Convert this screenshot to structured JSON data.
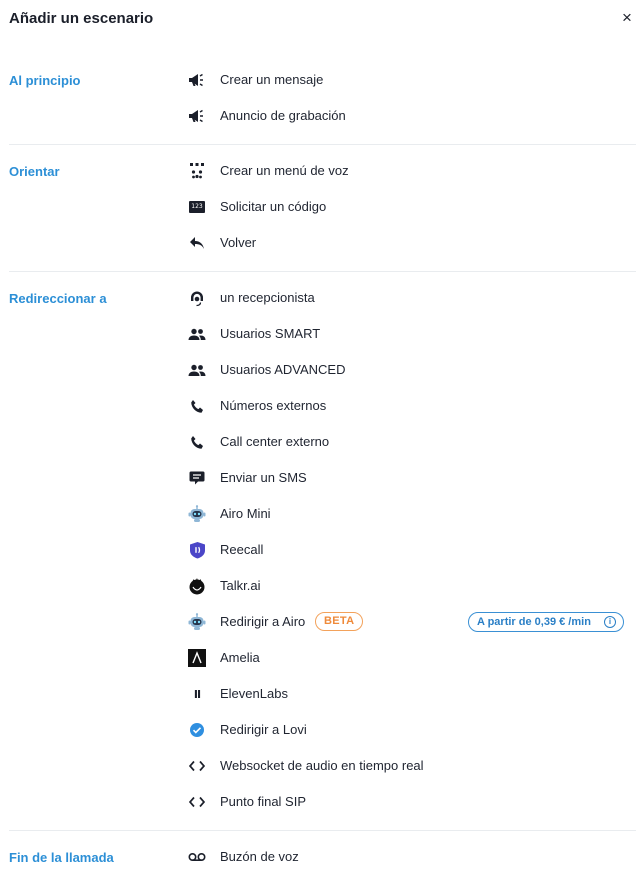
{
  "header": {
    "title": "Añadir un escenario",
    "close_label": "×"
  },
  "sections": [
    {
      "title": "Al principio",
      "items": [
        {
          "icon": "megaphone-icon",
          "label": "Crear un mensaje"
        },
        {
          "icon": "megaphone-icon",
          "label": "Anuncio de grabación"
        }
      ]
    },
    {
      "title": "Orientar",
      "items": [
        {
          "icon": "dialpad-icon",
          "label": "Crear un menú de voz"
        },
        {
          "icon": "keypad-code-icon",
          "label": "Solicitar un código",
          "glyph": "123"
        },
        {
          "icon": "reply-icon",
          "label": "Volver"
        }
      ]
    },
    {
      "title": "Redireccionar a",
      "items": [
        {
          "icon": "receptionist-icon",
          "label": "un recepcionista"
        },
        {
          "icon": "group-icon",
          "label": "Usuarios SMART"
        },
        {
          "icon": "group-icon",
          "label": "Usuarios ADVANCED"
        },
        {
          "icon": "phone-icon",
          "label": "Números externos"
        },
        {
          "icon": "phone-icon",
          "label": "Call center externo"
        },
        {
          "icon": "sms-icon",
          "label": "Enviar un SMS"
        },
        {
          "icon": "robot-icon",
          "label": "Airo Mini"
        },
        {
          "icon": "reecall-logo-icon",
          "label": "Reecall"
        },
        {
          "icon": "talkr-logo-icon",
          "label": "Talkr.ai"
        },
        {
          "icon": "robot-icon",
          "label": "Redirigir a Airo",
          "badge": "BETA",
          "price": "A partir de 0,39 € /min",
          "price_info": "i"
        },
        {
          "icon": "amelia-logo-icon",
          "label": "Amelia"
        },
        {
          "icon": "elevenlabs-logo-icon",
          "label": "ElevenLabs",
          "glyph": "II"
        },
        {
          "icon": "lovi-check-icon",
          "label": "Redirigir a Lovi"
        },
        {
          "icon": "code-icon",
          "label": "Websocket de audio en tiempo real"
        },
        {
          "icon": "code-icon",
          "label": "Punto final SIP"
        }
      ]
    },
    {
      "title": "Fin de la llamada",
      "items": [
        {
          "icon": "voicemail-icon",
          "label": "Buzón de voz"
        }
      ]
    }
  ],
  "colors": {
    "accent": "#2c8fd6",
    "beta": "#ef8a3a",
    "price": "#2a7fc6",
    "reecall": "#4b46c8",
    "lovi": "#2f8fe0"
  }
}
